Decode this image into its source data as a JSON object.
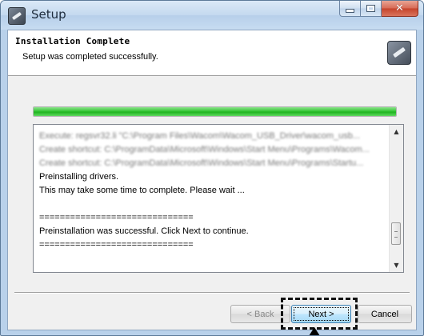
{
  "window": {
    "title": "Setup",
    "controls": {
      "minimize": "minimize",
      "maximize": "maximize",
      "close": "✕"
    }
  },
  "header": {
    "title": "Installation Complete",
    "subtitle": "Setup was completed successfully."
  },
  "progress": {
    "percent": 100,
    "color": "#2fbf2f"
  },
  "log": {
    "lines": [
      {
        "text": "Execute: regsvr32.li \"C:\\Program Files\\Wacom\\Wacom_USB_Driver\\wacom_usb...",
        "blurred": true
      },
      {
        "text": "Create shortcut: C:\\ProgramData\\Microsoft\\Windows\\Start Menu\\Programs\\Wacom...",
        "blurred": true
      },
      {
        "text": "Create shortcut: C:\\ProgramData\\Microsoft\\Windows\\Start Menu\\Programs\\Startu...",
        "blurred": true
      },
      {
        "text": "Preinstalling drivers.",
        "blurred": false
      },
      {
        "text": "This may take some time to complete. Please wait ...",
        "blurred": false
      },
      {
        "text": "",
        "blurred": false
      },
      {
        "text": "==============================",
        "blurred": false
      },
      {
        "text": "Preinstallation was successful. Click Next to continue.",
        "blurred": false
      },
      {
        "text": "==============================",
        "blurred": false
      }
    ],
    "scroll_position": 0.85
  },
  "buttons": {
    "back": "< Back",
    "next": "Next >",
    "cancel": "Cancel"
  }
}
